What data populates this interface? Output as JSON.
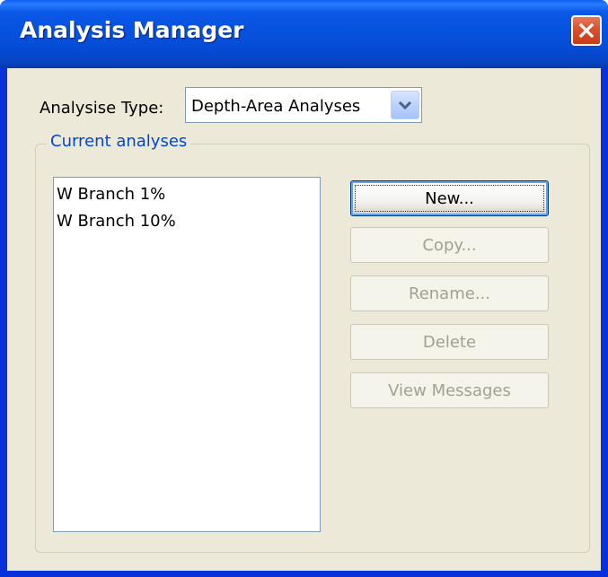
{
  "window": {
    "title": "Analysis Manager"
  },
  "analysis_type": {
    "label": "Analysise Type:",
    "selected": "Depth-Area Analyses"
  },
  "current_analyses": {
    "group_label": "Current analyses",
    "items": [
      "W Branch 1%",
      "W Branch 10%"
    ]
  },
  "buttons": {
    "new": "New...",
    "copy": "Copy...",
    "rename": "Rename...",
    "delete": "Delete",
    "view_messages": "View Messages"
  },
  "colors": {
    "title_bar": "#0651de",
    "dialog_face": "#ece9d8",
    "group_label": "#0046d5",
    "close_button": "#d8502c"
  }
}
